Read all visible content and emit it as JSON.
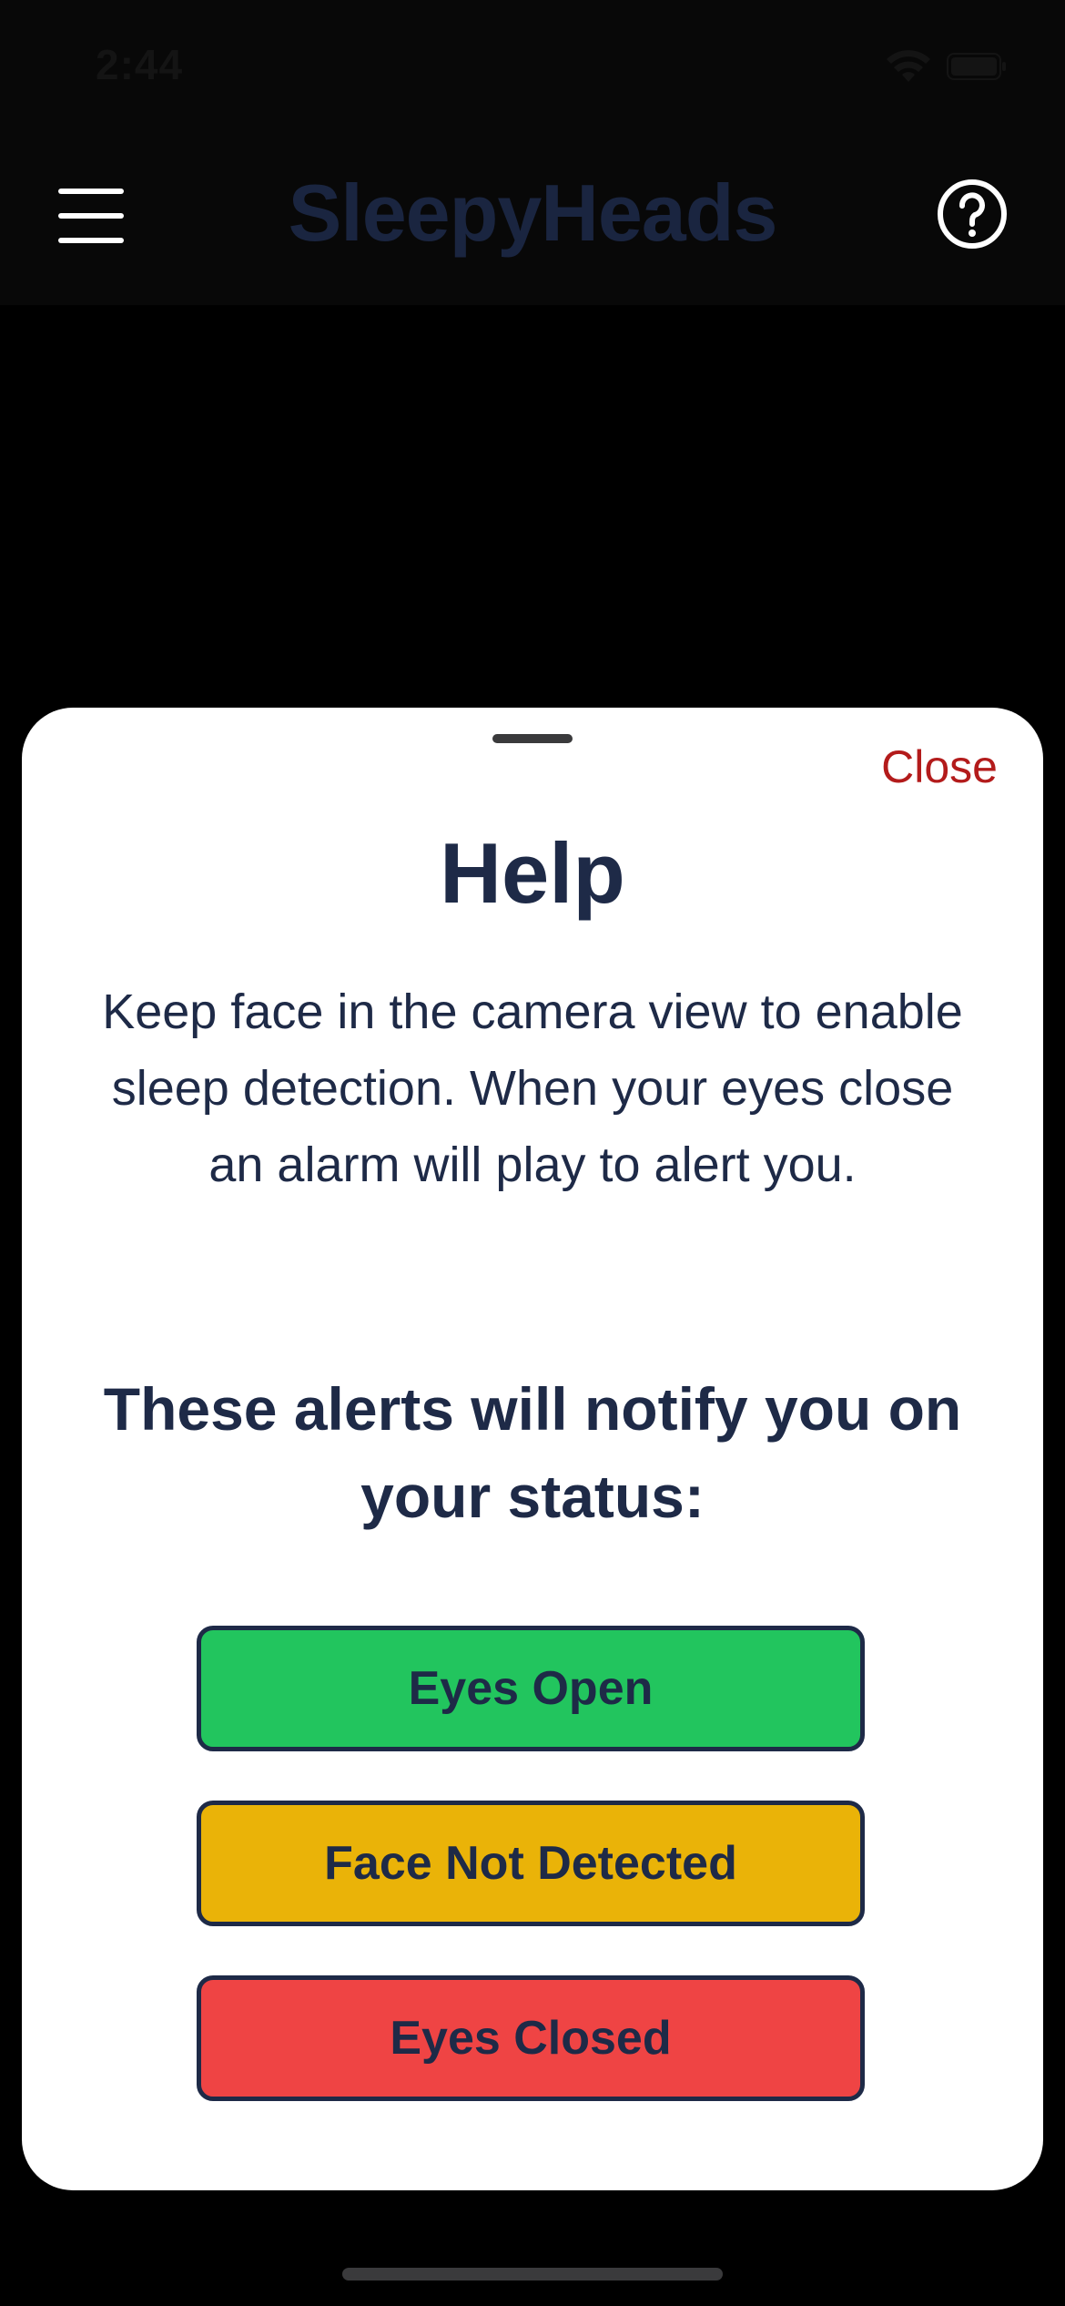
{
  "status_bar": {
    "time": "2:44"
  },
  "header": {
    "title": "SleepyHeads",
    "menu_icon": "hamburger-menu-icon",
    "help_icon": "question-circle-icon"
  },
  "help_sheet": {
    "close_label": "Close",
    "title": "Help",
    "body": "Keep face in the camera view to enable sleep detection. When your eyes close an alarm will play to alert you.",
    "subheading": "These alerts will notify you on your status:",
    "statuses": [
      {
        "label": "Eyes Open",
        "color": "#22c55e"
      },
      {
        "label": "Face Not Detected",
        "color": "#eab308"
      },
      {
        "label": "Eyes Closed",
        "color": "#ef4444"
      }
    ]
  },
  "colors": {
    "accent_text": "#1e2a47",
    "close": "#b31b1b"
  }
}
